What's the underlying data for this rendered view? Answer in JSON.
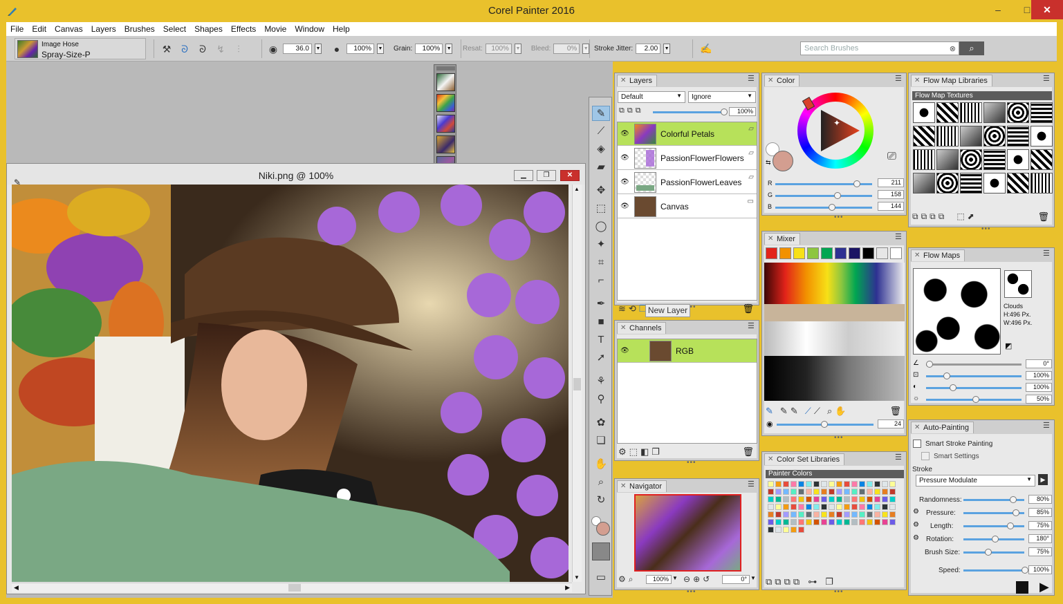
{
  "app": {
    "title": "Corel Painter 2016",
    "icon": "painter-brush-icon"
  },
  "window_controls": {
    "minimize": "‒",
    "maximize": "□",
    "close": "✕"
  },
  "menu": [
    "File",
    "Edit",
    "Canvas",
    "Layers",
    "Brushes",
    "Select",
    "Shapes",
    "Effects",
    "Movie",
    "Window",
    "Help"
  ],
  "property_bar": {
    "brush_category": "Image Hose",
    "brush_variant": "Spray-Size-P",
    "size": "36.0",
    "opacity": "100%",
    "grain_label": "Grain:",
    "grain": "100%",
    "resat_label": "Resat:",
    "resat": "100%",
    "bleed_label": "Bleed:",
    "bleed": "0%",
    "stroke_jitter_label": "Stroke Jitter:",
    "stroke_jitter": "2.00",
    "search_placeholder": "Search Brushes"
  },
  "document": {
    "title": "Niki.png @ 100%"
  },
  "layers": {
    "tab": "Layers",
    "composite_method": "Default",
    "preserve": "Ignore",
    "opacity": "100%",
    "items": [
      {
        "name": "Colorful Petals",
        "selected": true
      },
      {
        "name": "PassionFlowerFlowers",
        "selected": false
      },
      {
        "name": "PassionFlowerLeaves",
        "selected": false
      },
      {
        "name": "Canvas",
        "selected": false
      }
    ],
    "tooltip": "New Layer"
  },
  "channels": {
    "tab": "Channels",
    "items": [
      {
        "name": "RGB"
      }
    ]
  },
  "navigator": {
    "tab": "Navigator",
    "zoom": "100%",
    "angle": "0°"
  },
  "color": {
    "tab": "Color",
    "r": "211",
    "g": "158",
    "b": "144",
    "r_label": "R",
    "g_label": "G",
    "b_label": "B",
    "main_color": "#d39e90"
  },
  "mixer": {
    "tab": "Mixer",
    "swatches": [
      "#e2231a",
      "#f29100",
      "#f7e017",
      "#8dc63f",
      "#00a651",
      "#2e3192",
      "#1b1464",
      "#000000",
      "#e6e6e6",
      "#ffffff"
    ],
    "brush_size": "24"
  },
  "color_set_libraries": {
    "tab": "Color Set Libraries",
    "set_name": "Painter Colors"
  },
  "flow_map_libraries": {
    "tab": "Flow Map Libraries",
    "section": "Flow Map Textures"
  },
  "flow_maps": {
    "tab": "Flow Maps",
    "name": "Clouds",
    "height": "H:496 Px.",
    "width": "W:496 Px.",
    "values": [
      "0°",
      "100%",
      "100%",
      "50%"
    ]
  },
  "auto_painting": {
    "tab": "Auto-Painting",
    "smart_stroke": "Smart Stroke Painting",
    "smart_settings": "Smart Settings",
    "stroke_label": "Stroke",
    "stroke": "Pressure Modulate",
    "params": [
      {
        "label": "Randomness:",
        "value": "80%"
      },
      {
        "label": "Pressure:",
        "value": "85%"
      },
      {
        "label": "Length:",
        "value": "75%"
      },
      {
        "label": "Rotation:",
        "value": "180°"
      },
      {
        "label": "Brush Size:",
        "value": "75%"
      }
    ],
    "speed_label": "Speed:",
    "speed": "100%"
  }
}
